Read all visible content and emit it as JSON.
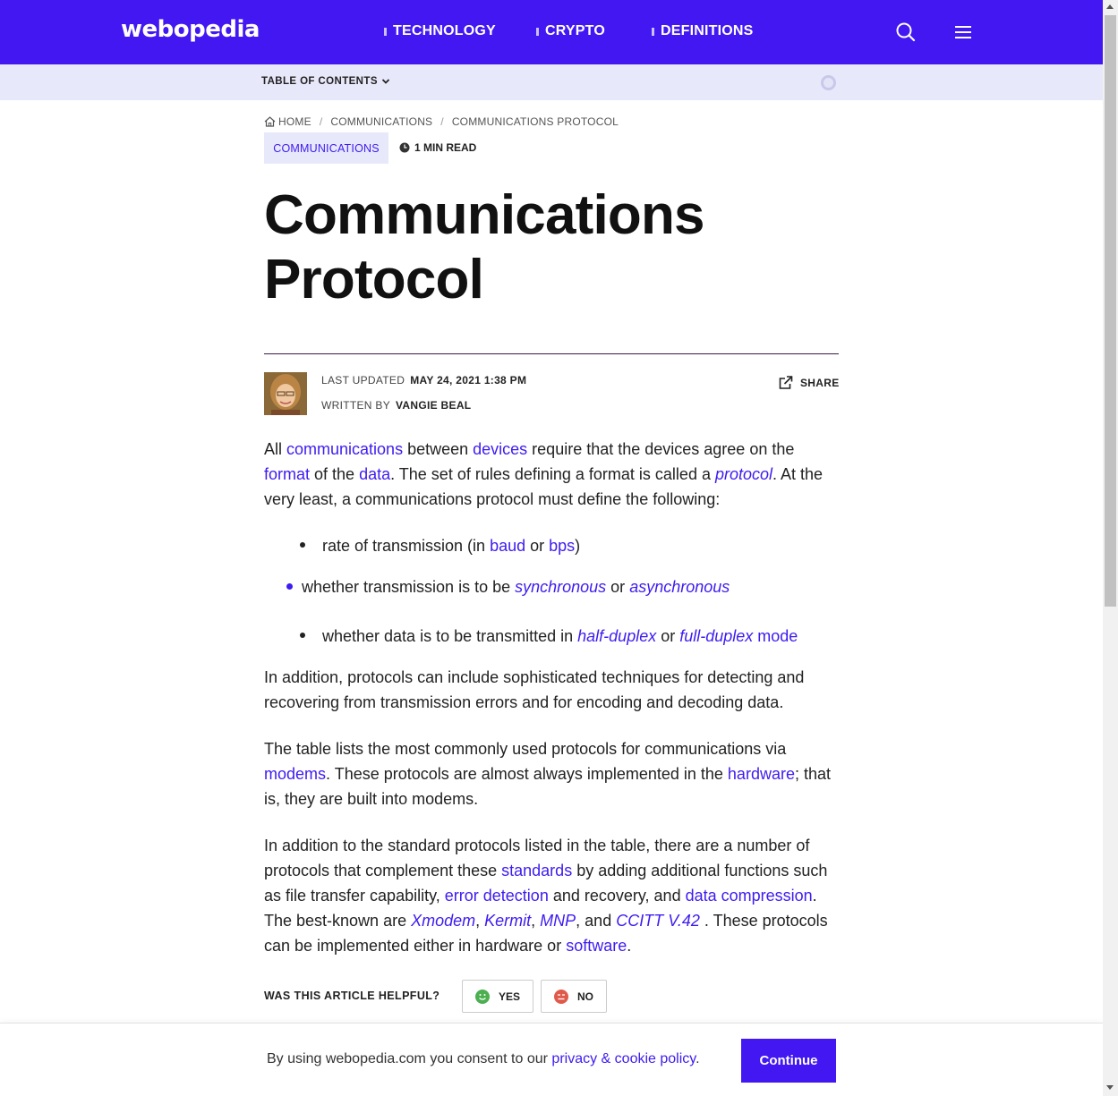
{
  "header": {
    "logo": "webopedia",
    "nav": [
      "TECHNOLOGY",
      "CRYPTO",
      "DEFINITIONS"
    ]
  },
  "toc": {
    "label": "TABLE OF CONTENTS"
  },
  "breadcrumb": [
    "HOME",
    "COMMUNICATIONS",
    "COMMUNICATIONS PROTOCOL"
  ],
  "category": "COMMUNICATIONS",
  "read_time": "1 MIN READ",
  "title": "Communications Protocol",
  "meta": {
    "updated_label": "LAST UPDATED",
    "updated_value": "MAY 24, 2021 1:38 PM",
    "author_label": "WRITTEN BY",
    "author_name": "VANGIE BEAL",
    "share": "SHARE"
  },
  "helpful": {
    "question": "WAS THIS ARTICLE HELPFUL?",
    "yes": "YES",
    "no": "NO"
  },
  "cookie": {
    "text": "By using webopedia.com you consent to our",
    "link": "privacy & cookie policy",
    "button": "Continue"
  },
  "article": {
    "p1": [
      "All ",
      "communications",
      " between ",
      "devices",
      " require that the devices agree on the ",
      "format",
      " of the ",
      "data",
      ". The set of rules defining a format is called a ",
      "protocol",
      ". At the very least, a communications protocol must define the following:"
    ],
    "li1": [
      "rate of transmission (in ",
      "baud",
      " or ",
      "bps",
      ")"
    ],
    "li2": [
      "whether transmission is to be ",
      "synchronous",
      " or ",
      "asynchronous"
    ],
    "li3": [
      "whether data is to be transmitted in ",
      "half-duplex",
      " or ",
      "full-duplex",
      " mode"
    ],
    "p2": "In addition, protocols can include sophisticated techniques for detecting and recovering from transmission errors and for encoding and decoding data.",
    "p3": [
      "The table lists the most commonly used protocols for communications via ",
      "modems",
      ". These protocols are almost always implemented in the ",
      "hardware",
      "; that is, they are built into modems."
    ],
    "p4": [
      "In addition to the standard protocols listed in the table, there are a number of protocols that complement these ",
      "standards",
      " by adding additional functions such as file transfer capability, ",
      "error detection",
      " and recovery, and ",
      "data compression",
      ". The best-known are ",
      "Xmodem",
      ", ",
      "Kermit",
      ", ",
      "MNP",
      ", and ",
      "CCITT V.42",
      " . These protocols can be implemented either in hardware or ",
      "software",
      "."
    ]
  },
  "colors": {
    "brand": "#4317f2",
    "link": "#3d1cf0",
    "toc_bg": "#e8e8fb"
  },
  "icons": [
    "search-icon",
    "menu-icon",
    "chevron-down-icon",
    "home-icon",
    "clock-icon",
    "share-icon",
    "smile-icon",
    "frown-icon"
  ]
}
